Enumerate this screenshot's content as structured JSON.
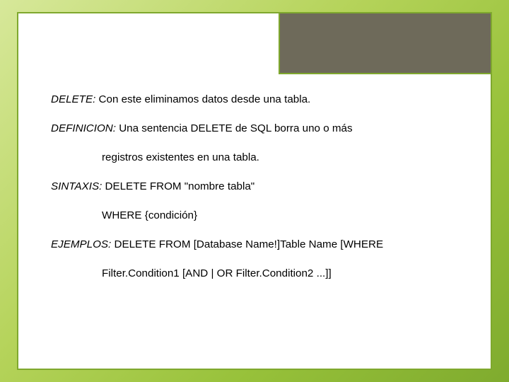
{
  "lines": {
    "delete_label": "DELETE:",
    "delete_text": " Con este eliminamos datos desde una tabla.",
    "definicion_label": "DEFINICION:",
    "definicion_text_1": " Una sentencia DELETE de SQL borra uno o más",
    "definicion_text_2": "registros existentes en una tabla.",
    "sintaxis_label": "SINTAXIS:",
    "sintaxis_text_1": " DELETE FROM \"nombre tabla\"",
    "sintaxis_text_2": "WHERE {condición}",
    "ejemplos_label": "EJEMPLOS:",
    "ejemplos_text_1": " DELETE FROM [Database Name!]Table Name [WHERE",
    "ejemplos_text_2": "Filter.Condition1 [AND | OR Filter.Condition2 ...]]"
  }
}
